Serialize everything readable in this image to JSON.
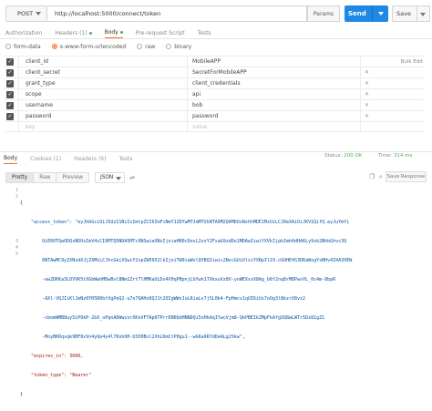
{
  "request": {
    "method": "POST",
    "url": "http://localhost:5000/connect/token",
    "params_label": "Params",
    "send_label": "Send",
    "save_label": "Save"
  },
  "tabs": [
    "Authorization",
    "Headers (1)",
    "Body",
    "Pre-request Script",
    "Tests"
  ],
  "active_tab": "Body",
  "body_types": [
    "form-data",
    "x-www-form-urlencoded",
    "raw",
    "binary"
  ],
  "selected_body_type": "x-www-form-urlencoded",
  "bulk_edit_label": "Bulk Edit",
  "params": [
    {
      "key": "client_id",
      "value": "MobileAPP"
    },
    {
      "key": "client_secret",
      "value": "SecretForMobileAPP"
    },
    {
      "key": "grant_type",
      "value": "client_credentials"
    },
    {
      "key": "scope",
      "value": "api"
    },
    {
      "key": "username",
      "value": "bob"
    },
    {
      "key": "password",
      "value": "password"
    }
  ],
  "new_row": {
    "key_placeholder": "key",
    "value_placeholder": "value"
  },
  "response": {
    "tabs": [
      "Body",
      "Cookies (1)",
      "Headers (6)",
      "Tests"
    ],
    "status_label": "Status:",
    "status_value": "200 OK",
    "time_label": "Time:",
    "time_value": "314 ms",
    "view_buttons": [
      "Pretty",
      "Raw",
      "Preview"
    ],
    "format": "JSON",
    "save_response_label": "Save Response",
    "line_numbers": [
      "1",
      "2",
      "",
      "",
      "",
      "",
      "",
      "",
      "3",
      "4",
      "5"
    ],
    "code_lines": [
      "{",
      "    \"access_token\": \"eyJhbGciOiJSUzI1NiIsImtpZCI6ImFiNmY1ZDYwMTJmMTVkNTA0M2Q4MDUzNzhhMDE1MzUiLCJ0eXAiOiJKV1QifQ.eyJuYmYi",
      "        OiE0OTQwODQxNDUsImV4cCI6MTQ5NDA5MTc0NSwiaXNzIjoiaHR0cDovL2xvY2FsaG9zdDo1MDAwIiwiYXVkIjpbImh0dHA6Ly9sb2NhbGhvc3Q",
      "        6NTAwMC9yZXNvdXJjZXMiLCJhcGkiXSwiY2xpZW50X2lkIjoiTW9iaWxlQVBQIiwic2NvcGUiOlsiYXBpIl19.oSUHE4S3DRaWsgYxNHv4Z4A3XEW",
      "        -ew2DKKa3LOVVK5tXGbWwhMDwBvl8Nm1Zrt7lHMKaULDx4V0qPBpnjLbYwh17XkxuVz8V-ynWEXxxX8Ag_b6f2nq8rM8PwvVL_0c4m-8bpR",
      "        -AXl-VQJIiKlJeNz0YR5R0btVgPeQ2-u7o7QAHz6QJ1t2OIgWWzJuLRiaLv7j5L0k4-FpHmcv1qUI6iUs7oOg3l8kzrX8vz2",
      "        -cbomWMB8uy5iPOkP-2bX_oPqnADWwcorXKnVFTAp6TPrr6N0QdHNNDQi5nHkAqIYwcVjm8-QkPBEIkZMpFkAfgSQ8wLWTr5Dz81gZ1",
      "        -MoyBKRqvqk9BF8xVn4yQe4y4l70ohXH-U3X0Bxl2XhLKmCtP0gu1--wG6a9R7dDeALgJSkw\",",
      "    \"expires_in\": 3600,",
      "    \"token_type\": \"Bearer\"",
      "}"
    ]
  }
}
